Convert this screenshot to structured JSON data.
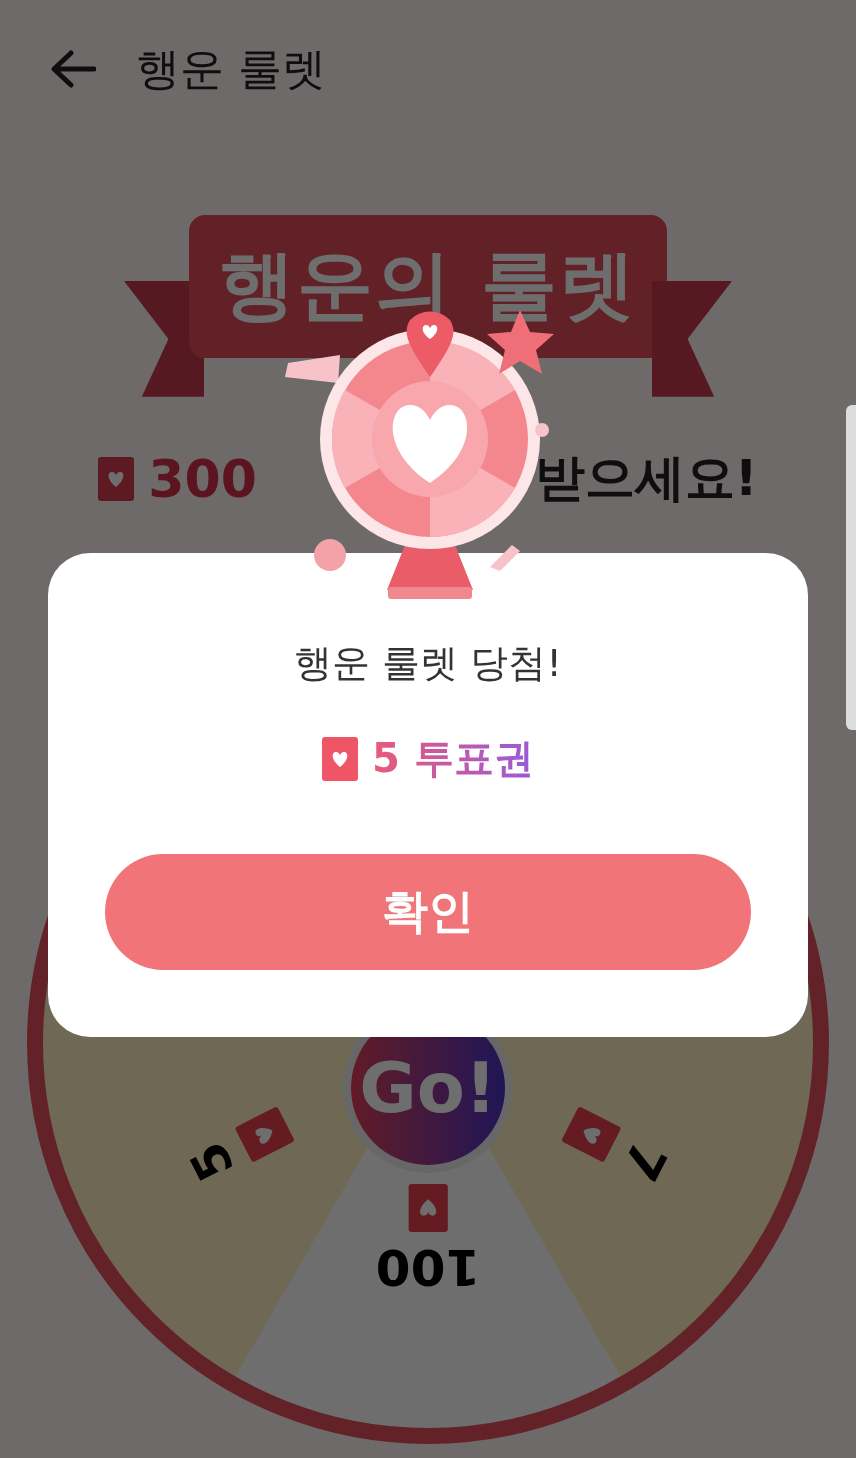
{
  "header": {
    "title": "행운 룰렛"
  },
  "banner": {
    "title": "행운의 룰렛"
  },
  "prompt": {
    "amount": "300",
    "suffix": "받으세요!"
  },
  "wheel": {
    "spin_label": "Go!",
    "segments": [
      {
        "kind": "yellow",
        "value": "5"
      },
      {
        "kind": "white",
        "value": "100"
      },
      {
        "kind": "yellow",
        "value": "7"
      }
    ]
  },
  "dialog": {
    "title": "행운 룰렛 당첨!",
    "reward": "5 투표권",
    "confirm": "확인"
  }
}
